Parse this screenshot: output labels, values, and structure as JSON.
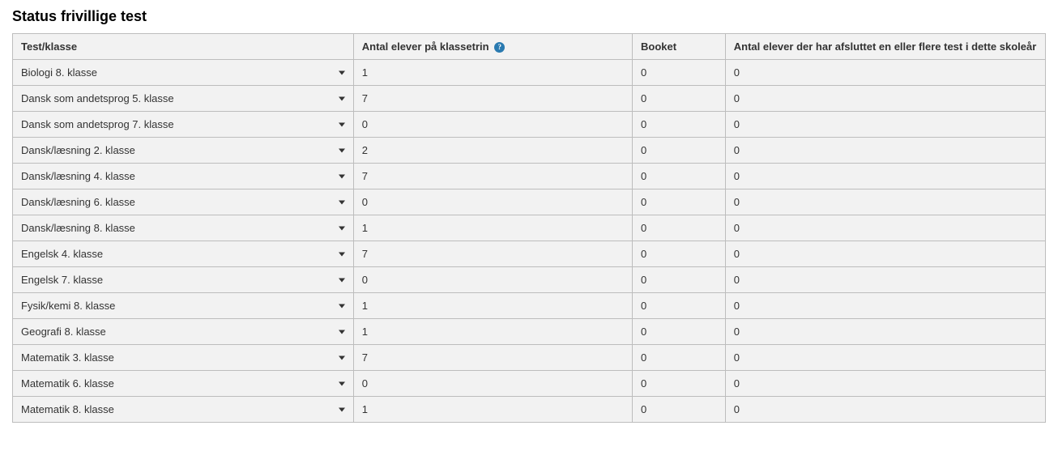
{
  "title": "Status frivillige test",
  "columns": {
    "test": "Test/klasse",
    "antal": "Antal elever på klassetrin",
    "booket": "Booket",
    "afsluttet": "Antal elever der har afsluttet en eller flere test i dette skoleår"
  },
  "info_symbol": "?",
  "rows": [
    {
      "test": "Biologi 8. klasse",
      "antal": "1",
      "booket": "0",
      "afsluttet": "0"
    },
    {
      "test": "Dansk som andetsprog 5. klasse",
      "antal": "7",
      "booket": "0",
      "afsluttet": "0"
    },
    {
      "test": "Dansk som andetsprog 7. klasse",
      "antal": "0",
      "booket": "0",
      "afsluttet": "0"
    },
    {
      "test": "Dansk/læsning 2. klasse",
      "antal": "2",
      "booket": "0",
      "afsluttet": "0"
    },
    {
      "test": "Dansk/læsning 4. klasse",
      "antal": "7",
      "booket": "0",
      "afsluttet": "0"
    },
    {
      "test": "Dansk/læsning 6. klasse",
      "antal": "0",
      "booket": "0",
      "afsluttet": "0"
    },
    {
      "test": "Dansk/læsning 8. klasse",
      "antal": "1",
      "booket": "0",
      "afsluttet": "0"
    },
    {
      "test": "Engelsk 4. klasse",
      "antal": "7",
      "booket": "0",
      "afsluttet": "0"
    },
    {
      "test": "Engelsk 7. klasse",
      "antal": "0",
      "booket": "0",
      "afsluttet": "0"
    },
    {
      "test": "Fysik/kemi 8. klasse",
      "antal": "1",
      "booket": "0",
      "afsluttet": "0"
    },
    {
      "test": "Geografi 8. klasse",
      "antal": "1",
      "booket": "0",
      "afsluttet": "0"
    },
    {
      "test": "Matematik 3. klasse",
      "antal": "7",
      "booket": "0",
      "afsluttet": "0"
    },
    {
      "test": "Matematik 6. klasse",
      "antal": "0",
      "booket": "0",
      "afsluttet": "0"
    },
    {
      "test": "Matematik 8. klasse",
      "antal": "1",
      "booket": "0",
      "afsluttet": "0"
    }
  ]
}
